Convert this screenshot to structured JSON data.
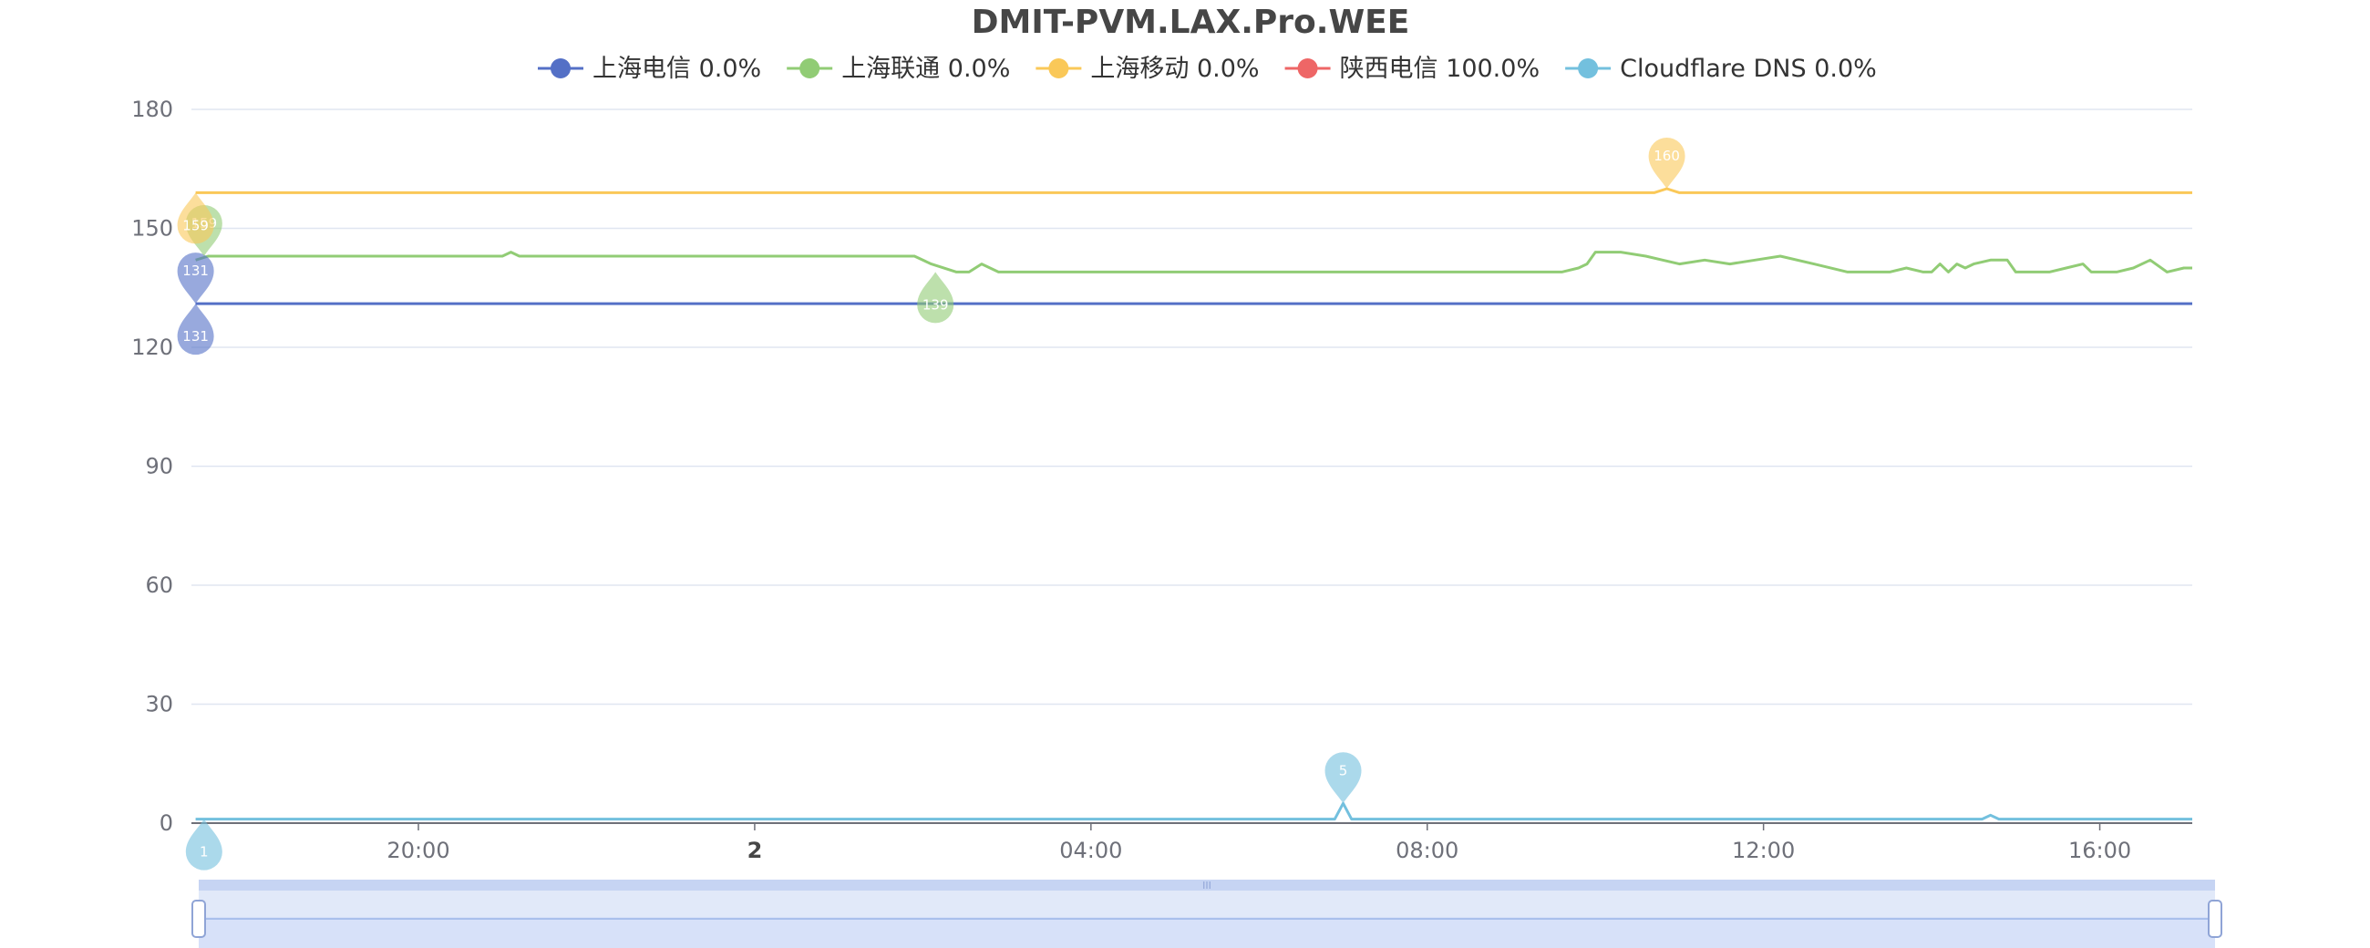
{
  "chart_data": {
    "type": "line",
    "title": "DMIT-PVM.LAX.Pro.WEE",
    "ylim": [
      0,
      180
    ],
    "yticks": [
      0,
      30,
      60,
      90,
      120,
      150,
      180
    ],
    "x_range_hours": [
      17.3,
      41.1
    ],
    "xticks": [
      {
        "hour": 20,
        "label": "20:00",
        "bold": false
      },
      {
        "hour": 24,
        "label": "2",
        "bold": true
      },
      {
        "hour": 28,
        "label": "04:00",
        "bold": false
      },
      {
        "hour": 32,
        "label": "08:00",
        "bold": false
      },
      {
        "hour": 36,
        "label": "12:00",
        "bold": false
      },
      {
        "hour": 40,
        "label": "16:00",
        "bold": false
      }
    ],
    "grid": true,
    "legend_position": "top-center",
    "series": [
      {
        "name": "上海电信",
        "loss": "0.0%",
        "color": "#5470c6",
        "x": [
          17.35,
          41.1
        ],
        "y": [
          131,
          131
        ],
        "markers": [
          {
            "label": "131",
            "x": 17.35,
            "y": 131,
            "kind": "max"
          },
          {
            "label": "131",
            "x": 17.35,
            "y": 131,
            "kind": "min"
          }
        ]
      },
      {
        "name": "上海联通",
        "loss": "0.0%",
        "color": "#91cc75",
        "x": [
          17.35,
          17.5,
          21.0,
          21.1,
          21.2,
          25.9,
          26.1,
          26.4,
          26.55,
          26.7,
          26.9,
          33.6,
          33.8,
          33.9,
          34.0,
          34.3,
          34.6,
          34.8,
          35.0,
          35.3,
          35.6,
          35.9,
          36.2,
          36.6,
          37.0,
          37.5,
          37.7,
          37.9,
          38.0,
          38.1,
          38.2,
          38.3,
          38.4,
          38.5,
          38.7,
          38.9,
          39.0,
          39.1,
          39.4,
          39.6,
          39.8,
          39.9,
          40.0,
          40.2,
          40.4,
          40.6,
          40.8,
          41.0,
          41.1
        ],
        "y": [
          142,
          143,
          143,
          144,
          143,
          143,
          141,
          139,
          139,
          141,
          139,
          139,
          140,
          141,
          144,
          144,
          143,
          142,
          141,
          142,
          141,
          142,
          143,
          141,
          139,
          139,
          140,
          139,
          139,
          141,
          139,
          141,
          140,
          141,
          142,
          142,
          139,
          139,
          139,
          140,
          141,
          139,
          139,
          139,
          140,
          142,
          139,
          140,
          140
        ],
        "markers": [
          {
            "label": "159",
            "x": 17.45,
            "y": 143,
            "kind": "max"
          },
          {
            "label": "139",
            "x": 26.15,
            "y": 139,
            "kind": "min"
          }
        ]
      },
      {
        "name": "上海移动",
        "loss": "0.0%",
        "color": "#fac858",
        "x": [
          17.35,
          34.7,
          34.85,
          35.0,
          41.1
        ],
        "y": [
          159,
          159,
          160,
          159,
          159
        ],
        "markers": [
          {
            "label": "160",
            "x": 34.85,
            "y": 160,
            "kind": "max"
          },
          {
            "label": "159",
            "x": 17.35,
            "y": 159,
            "kind": "min"
          }
        ]
      },
      {
        "name": "陕西电信",
        "loss": "100.0%",
        "color": "#ee6666",
        "x": [],
        "y": [],
        "markers": []
      },
      {
        "name": "Cloudflare DNS",
        "loss": "0.0%",
        "color": "#73c0de",
        "x": [
          17.35,
          30.9,
          31.0,
          31.1,
          31.2,
          38.6,
          38.7,
          38.8,
          41.1
        ],
        "y": [
          1,
          1,
          5,
          1,
          1,
          1,
          2,
          1,
          1
        ],
        "markers": [
          {
            "label": "5",
            "x": 31.0,
            "y": 5,
            "kind": "max"
          },
          {
            "label": "1",
            "x": 17.45,
            "y": 1,
            "kind": "min"
          }
        ]
      }
    ]
  },
  "datazoom": {
    "start": 0,
    "end": 100,
    "handle_label": "III"
  }
}
